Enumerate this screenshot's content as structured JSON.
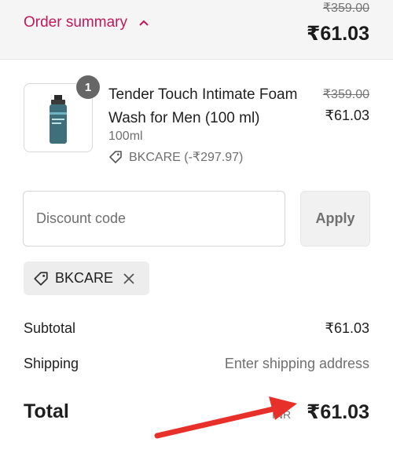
{
  "header": {
    "toggle_label": "Order summary",
    "compare_price": "₹359.00",
    "total": "₹61.03"
  },
  "item": {
    "quantity": "1",
    "title": "Tender Touch Intimate Foam Wash for Men (100 ml)",
    "variant": "100ml",
    "discount_line": "BKCARE (-₹297.97)",
    "compare_price": "₹359.00",
    "price": "₹61.03",
    "thumb_text": "BKCARE"
  },
  "discount": {
    "placeholder": "Discount code",
    "apply_label": "Apply",
    "applied_code": "BKCARE"
  },
  "totals": {
    "subtotal_label": "Subtotal",
    "subtotal_value": "₹61.03",
    "shipping_label": "Shipping",
    "shipping_value": "Enter shipping address",
    "total_label": "Total",
    "total_currency": "INR",
    "total_value": "₹61.03"
  },
  "colors": {
    "accent": "#c2185b",
    "annotation_arrow": "#e8302a"
  }
}
